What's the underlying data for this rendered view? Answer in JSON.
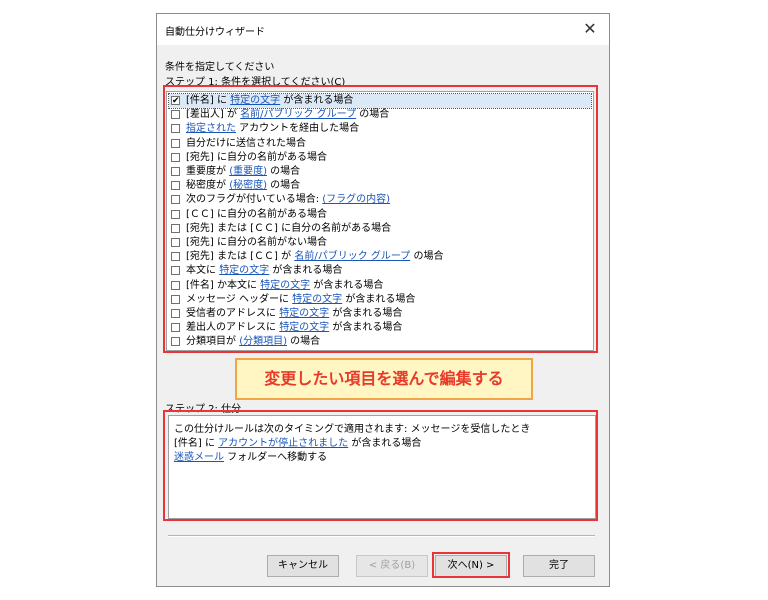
{
  "window": {
    "title": "自動仕分けウィザード",
    "close_glyph": "✕"
  },
  "header": {
    "instruction": "条件を指定してください",
    "step1_label": "ステップ 1: 条件を選択してください(C)"
  },
  "conditions": [
    {
      "checked": true,
      "parts": [
        [
          "[件名] に ",
          false
        ],
        [
          "特定の文字",
          true
        ],
        [
          " が含まれる場合",
          false
        ]
      ]
    },
    {
      "checked": false,
      "parts": [
        [
          "[差出人] が ",
          false
        ],
        [
          "名前/パブリック グループ",
          true
        ],
        [
          " の場合",
          false
        ]
      ]
    },
    {
      "checked": false,
      "parts": [
        [
          "指定された",
          true
        ],
        [
          " アカウントを経由した場合",
          false
        ]
      ]
    },
    {
      "checked": false,
      "parts": [
        [
          "自分だけに送信された場合",
          false
        ]
      ]
    },
    {
      "checked": false,
      "parts": [
        [
          "[宛先] に自分の名前がある場合",
          false
        ]
      ]
    },
    {
      "checked": false,
      "parts": [
        [
          "重要度が ",
          false
        ],
        [
          "(重要度)",
          true
        ],
        [
          " の場合",
          false
        ]
      ]
    },
    {
      "checked": false,
      "parts": [
        [
          "秘密度が ",
          false
        ],
        [
          "(秘密度)",
          true
        ],
        [
          " の場合",
          false
        ]
      ]
    },
    {
      "checked": false,
      "parts": [
        [
          "次のフラグが付いている場合: ",
          false
        ],
        [
          "(フラグの内容)",
          true
        ]
      ]
    },
    {
      "checked": false,
      "parts": [
        [
          "[ＣＣ] に自分の名前がある場合",
          false
        ]
      ]
    },
    {
      "checked": false,
      "parts": [
        [
          "[宛先] または [ＣＣ] に自分の名前がある場合",
          false
        ]
      ]
    },
    {
      "checked": false,
      "parts": [
        [
          "[宛先] に自分の名前がない場合",
          false
        ]
      ]
    },
    {
      "checked": false,
      "parts": [
        [
          "[宛先] または [ＣＣ] が ",
          false
        ],
        [
          "名前/パブリック グループ",
          true
        ],
        [
          " の場合",
          false
        ]
      ]
    },
    {
      "checked": false,
      "parts": [
        [
          "本文に ",
          false
        ],
        [
          "特定の文字",
          true
        ],
        [
          " が含まれる場合",
          false
        ]
      ]
    },
    {
      "checked": false,
      "parts": [
        [
          "[件名] か本文に ",
          false
        ],
        [
          "特定の文字",
          true
        ],
        [
          " が含まれる場合",
          false
        ]
      ]
    },
    {
      "checked": false,
      "parts": [
        [
          "メッセージ ヘッダーに ",
          false
        ],
        [
          "特定の文字",
          true
        ],
        [
          " が含まれる場合",
          false
        ]
      ]
    },
    {
      "checked": false,
      "parts": [
        [
          "受信者のアドレスに ",
          false
        ],
        [
          "特定の文字",
          true
        ],
        [
          " が含まれる場合",
          false
        ]
      ]
    },
    {
      "checked": false,
      "parts": [
        [
          "差出人のアドレスに ",
          false
        ],
        [
          "特定の文字",
          true
        ],
        [
          " が含まれる場合",
          false
        ]
      ]
    },
    {
      "checked": false,
      "parts": [
        [
          "分類項目が ",
          false
        ],
        [
          "(分類項目)",
          true
        ],
        [
          " の場合",
          false
        ]
      ]
    }
  ],
  "callout": {
    "text": "変更したい項目を選んで編集する"
  },
  "step2": {
    "label_visible": "ステップ 2: 仕分",
    "description_lines": [
      [
        [
          "この仕分けルールは次のタイミングで適用されます: メッセージを受信したとき",
          false
        ]
      ],
      [
        [
          "[件名] に ",
          false
        ],
        [
          "アカウントが停止されました",
          true
        ],
        [
          " が含まれる場合",
          false
        ]
      ],
      [
        [
          "迷惑メール",
          true
        ],
        [
          " フォルダーへ移動する",
          false
        ]
      ]
    ]
  },
  "buttons": {
    "cancel": "キャンセル",
    "back": "< 戻る(B)",
    "next": "次へ(N) >",
    "finish": "完了"
  },
  "colors": {
    "highlight": "#e8353a",
    "callout_text": "#e83a2b",
    "callout_bg": "#fff6c4",
    "link": "#1a56b8"
  }
}
